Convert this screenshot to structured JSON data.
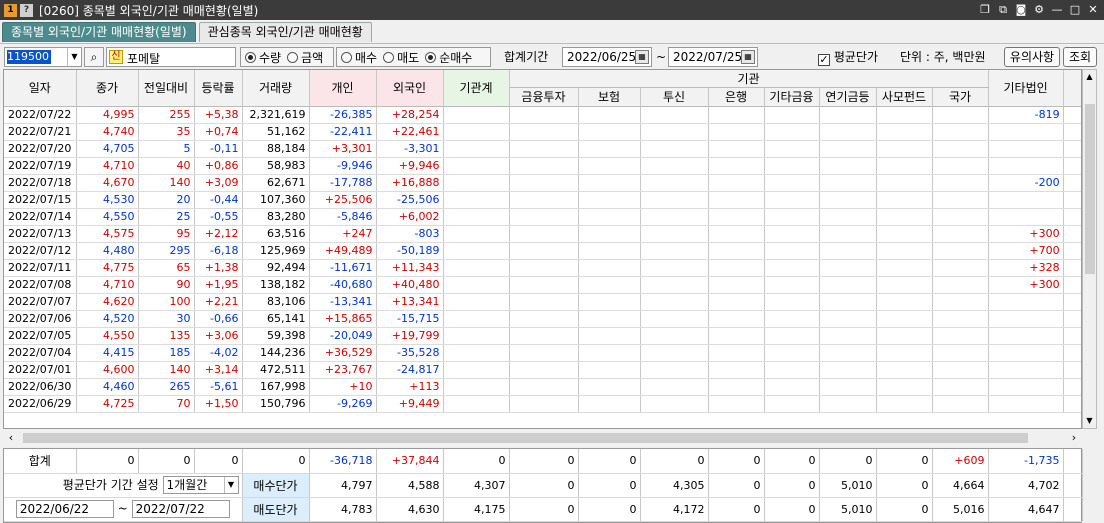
{
  "window": {
    "title": "[0260] 종목별 외국인/기관 매매현황(일별)",
    "controls": [
      "restore-icon",
      "copy-icon",
      "camera-icon",
      "gear-icon",
      "minimize-icon",
      "maximize-icon",
      "close-icon"
    ]
  },
  "tabs": [
    {
      "label": "종목별 외국인/기관 매매현황(일별)",
      "active": true
    },
    {
      "label": "관심종목 외국인/기관 매매현황",
      "active": false
    }
  ],
  "toolbar": {
    "code": "119500",
    "badge": "신",
    "name": "포메탈",
    "radio_group1": [
      {
        "label": "수량",
        "on": true
      },
      {
        "label": "금액",
        "on": false
      }
    ],
    "radio_group2": [
      {
        "label": "매수",
        "on": false
      },
      {
        "label": "매도",
        "on": false
      },
      {
        "label": "순매수",
        "on": true
      }
    ],
    "period_label": "합계기간",
    "date_from": "2022/06/25",
    "tilde": "~",
    "date_to": "2022/07/25",
    "avg_price_label": "평균단가",
    "avg_price_checked": true,
    "unit_label": "단위 : 주, 백만원",
    "notice_button": "유의사항",
    "query_button": "조회"
  },
  "grid": {
    "headers": {
      "date": "일자",
      "close": "종가",
      "change": "전일대비",
      "rate": "등락률",
      "volume": "거래량",
      "individual": "개인",
      "foreign": "외국인",
      "inst_total": "기관계",
      "inst_group": "기관",
      "fin_invest": "금융투자",
      "insurance": "보험",
      "trust": "투신",
      "bank": "은행",
      "other_fin": "기타금융",
      "pension": "연기금등",
      "private_fund": "사모펀드",
      "nation": "국가",
      "other_corp": "기타법인",
      "cut": "기"
    },
    "rows": [
      {
        "date": "2022/07/22",
        "close": "4,995",
        "change": "255",
        "rate": "+5,38",
        "volume": "2,321,619",
        "individual": "-26,385",
        "foreign": "+28,254",
        "other_corp": "-819"
      },
      {
        "date": "2022/07/21",
        "close": "4,740",
        "change": "35",
        "rate": "+0,74",
        "volume": "51,162",
        "individual": "-22,411",
        "foreign": "+22,461",
        "other_corp": ""
      },
      {
        "date": "2022/07/20",
        "close": "4,705",
        "change": "5",
        "rate": "-0,11",
        "volume": "88,184",
        "individual": "+3,301",
        "foreign": "-3,301",
        "other_corp": ""
      },
      {
        "date": "2022/07/19",
        "close": "4,710",
        "change": "40",
        "rate": "+0,86",
        "volume": "58,983",
        "individual": "-9,946",
        "foreign": "+9,946",
        "other_corp": ""
      },
      {
        "date": "2022/07/18",
        "close": "4,670",
        "change": "140",
        "rate": "+3,09",
        "volume": "62,671",
        "individual": "-17,788",
        "foreign": "+16,888",
        "other_corp": "-200"
      },
      {
        "date": "2022/07/15",
        "close": "4,530",
        "change": "20",
        "rate": "-0,44",
        "volume": "107,360",
        "individual": "+25,506",
        "foreign": "-25,506",
        "other_corp": ""
      },
      {
        "date": "2022/07/14",
        "close": "4,550",
        "change": "25",
        "rate": "-0,55",
        "volume": "83,280",
        "individual": "-5,846",
        "foreign": "+6,002",
        "other_corp": ""
      },
      {
        "date": "2022/07/13",
        "close": "4,575",
        "change": "95",
        "rate": "+2,12",
        "volume": "63,516",
        "individual": "+247",
        "foreign": "-803",
        "other_corp": "+300"
      },
      {
        "date": "2022/07/12",
        "close": "4,480",
        "change": "295",
        "rate": "-6,18",
        "volume": "125,969",
        "individual": "+49,489",
        "foreign": "-50,189",
        "other_corp": "+700"
      },
      {
        "date": "2022/07/11",
        "close": "4,775",
        "change": "65",
        "rate": "+1,38",
        "volume": "92,494",
        "individual": "-11,671",
        "foreign": "+11,343",
        "other_corp": "+328"
      },
      {
        "date": "2022/07/08",
        "close": "4,710",
        "change": "90",
        "rate": "+1,95",
        "volume": "138,182",
        "individual": "-40,680",
        "foreign": "+40,480",
        "other_corp": "+300"
      },
      {
        "date": "2022/07/07",
        "close": "4,620",
        "change": "100",
        "rate": "+2,21",
        "volume": "83,106",
        "individual": "-13,341",
        "foreign": "+13,341",
        "other_corp": ""
      },
      {
        "date": "2022/07/06",
        "close": "4,520",
        "change": "30",
        "rate": "-0,66",
        "volume": "65,141",
        "individual": "+15,865",
        "foreign": "-15,715",
        "other_corp": ""
      },
      {
        "date": "2022/07/05",
        "close": "4,550",
        "change": "135",
        "rate": "+3,06",
        "volume": "59,398",
        "individual": "-20,049",
        "foreign": "+19,799",
        "other_corp": ""
      },
      {
        "date": "2022/07/04",
        "close": "4,415",
        "change": "185",
        "rate": "-4,02",
        "volume": "144,236",
        "individual": "+36,529",
        "foreign": "-35,528",
        "other_corp": ""
      },
      {
        "date": "2022/07/01",
        "close": "4,600",
        "change": "140",
        "rate": "+3,14",
        "volume": "472,511",
        "individual": "+23,767",
        "foreign": "-24,817",
        "other_corp": ""
      },
      {
        "date": "2022/06/30",
        "close": "4,460",
        "change": "265",
        "rate": "-5,61",
        "volume": "167,998",
        "individual": "+10",
        "foreign": "+113",
        "other_corp": ""
      },
      {
        "date": "2022/06/29",
        "close": "4,725",
        "change": "70",
        "rate": "+1,50",
        "volume": "150,796",
        "individual": "-9,269",
        "foreign": "+9,449",
        "other_corp": ""
      }
    ]
  },
  "summary": {
    "total_label": "합계",
    "total": [
      "0",
      "0",
      "0",
      "0",
      "-36,718",
      "+37,844",
      "0",
      "0",
      "0",
      "0",
      "0",
      "0",
      "0",
      "0",
      "+609",
      "-1,735"
    ],
    "avg_period_label": "평균단가 기간 설정",
    "avg_period_value": "1개월간",
    "buy_avg_label": "매수단가",
    "buy_avg": [
      "4,797",
      "4,588",
      "4,307",
      "0",
      "0",
      "4,305",
      "0",
      "0",
      "5,010",
      "0",
      "4,664",
      "4,702"
    ],
    "sell_avg_label": "매도단가",
    "sell_avg": [
      "4,783",
      "4,630",
      "4,175",
      "0",
      "0",
      "4,172",
      "0",
      "0",
      "5,010",
      "0",
      "5,016",
      "4,647"
    ],
    "avg_from": "2022/06/22",
    "avg_tilde": "~",
    "avg_to": "2022/07/22"
  },
  "colors": {
    "up": "#d00000",
    "down": "#0033cc",
    "tab_active": "#4d8a8b",
    "pink_header": "#fbe5e8",
    "green_header": "#e7f5e4",
    "blue_label": "#dceefb"
  }
}
